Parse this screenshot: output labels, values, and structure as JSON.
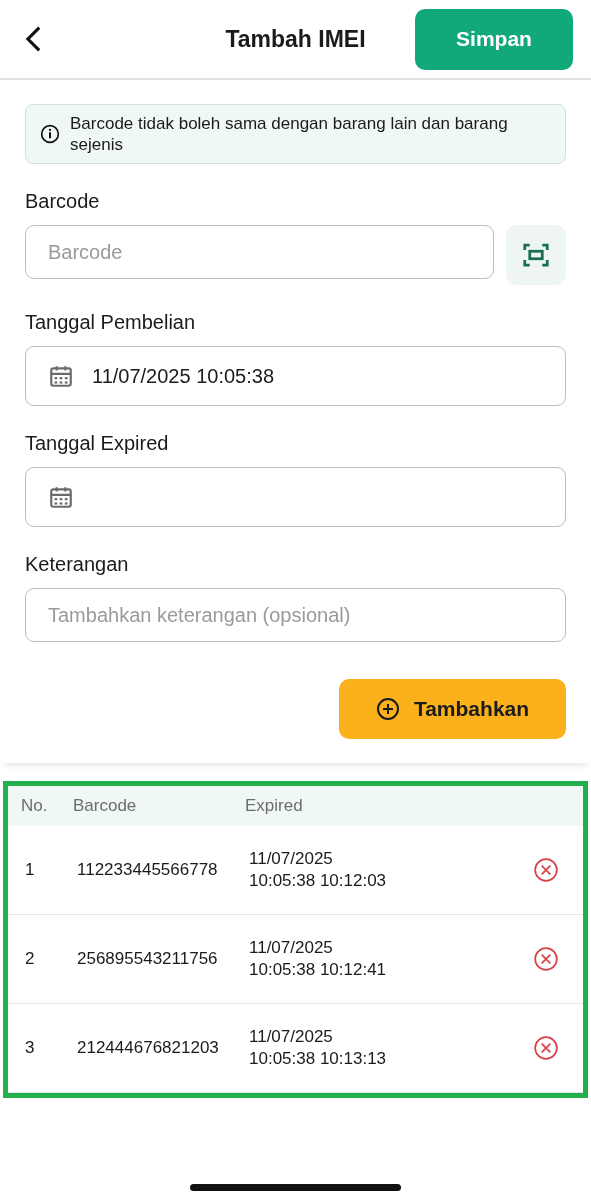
{
  "header": {
    "title": "Tambah IMEI",
    "save_button": "Simpan"
  },
  "notice": "Barcode tidak boleh sama dengan barang lain dan barang sejenis",
  "fields": [
    {
      "kind": "barcode",
      "label": "Barcode",
      "placeholder": "Barcode"
    },
    {
      "kind": "date",
      "label": "Tanggal Pembelian",
      "value": "11/07/2025 10:05:38"
    },
    {
      "kind": "date",
      "label": "Tanggal Expired"
    },
    {
      "kind": "text",
      "label": "Keterangan",
      "placeholder": "Tambahkan keterangan (opsional)"
    }
  ],
  "add_button": "Tambahkan",
  "table": {
    "columns": [
      "No.",
      "Barcode",
      "Expired"
    ],
    "rows": [
      {
        "no": "1",
        "barcode": "112233445566778",
        "expired": "11/07/2025 10:05:38 10:12:03"
      },
      {
        "no": "2",
        "barcode": "256895543211756",
        "expired": "11/07/2025 10:05:38 10:12:41"
      },
      {
        "no": "3",
        "barcode": "212444676821203",
        "expired": "11/07/2025 10:05:38 10:13:13"
      }
    ]
  }
}
